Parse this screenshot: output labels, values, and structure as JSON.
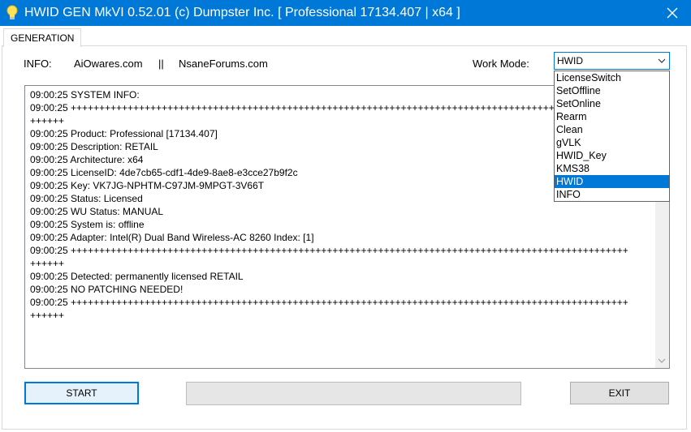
{
  "window": {
    "title": "HWID GEN MkVI 0.52.01 (c) Dumpster Inc. [ Professional 17134.407 | x64 ]",
    "accent_color": "#0078d7",
    "icon": "lightbulb-icon"
  },
  "tabs": [
    {
      "label": "GENERATION",
      "active": true
    }
  ],
  "info": {
    "label": "INFO:",
    "link1": "AiOwares.com",
    "separator": "||",
    "link2": "NsaneForums.com"
  },
  "work_mode": {
    "label": "Work Mode:",
    "selected": "HWID",
    "options": [
      "LicenseSwitch",
      "SetOffline",
      "SetOnline",
      "Rearm",
      "Clean",
      "gVLK",
      "HWID_Key",
      "KMS38",
      "HWID",
      "INFO"
    ]
  },
  "log": [
    "09:00:25 SYSTEM INFO:",
    "09:00:25 ++++++++++++++++++++++++++++++++++++++++++++++++++++++++++++++++++++++++++++++++++++++++++++++++++",
    "++++++",
    "09:00:25 Product: Professional [17134.407]",
    "09:00:25 Description: RETAIL",
    "09:00:25 Architecture: x64",
    "09:00:25 LicenseID: 4de7cb65-cdf1-4de9-8ae8-e3cce27b9f2c",
    "09:00:25 Key: VK7JG-NPHTM-C97JM-9MPGT-3V66T",
    "09:00:25 Status: Licensed",
    "09:00:25 WU Status: MANUAL",
    "09:00:25 System is: offline",
    "09:00:25 Adapter: Intel(R) Dual Band Wireless-AC 8260 Index: [1]",
    "09:00:25 ++++++++++++++++++++++++++++++++++++++++++++++++++++++++++++++++++++++++++++++++++++++++++++++++++",
    "++++++",
    "09:00:25 Detected: permanently licensed RETAIL",
    "09:00:25 NO PATCHING NEEDED!",
    "09:00:25 ++++++++++++++++++++++++++++++++++++++++++++++++++++++++++++++++++++++++++++++++++++++++++++++++++",
    "++++++"
  ],
  "buttons": {
    "start": "START",
    "exit": "EXIT"
  },
  "progress": {
    "value": 0
  }
}
